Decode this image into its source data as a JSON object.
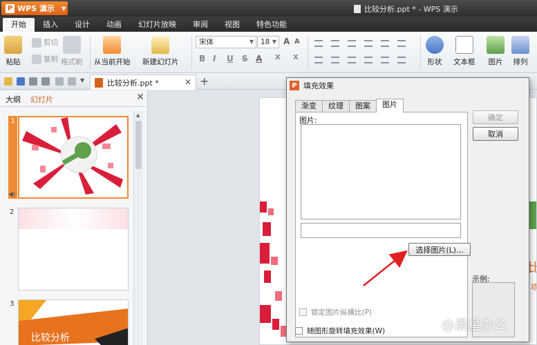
{
  "titlebar": {
    "app_label": "WPS 演示",
    "doc_title": "比较分析.ppt * - WPS 演示"
  },
  "menu": {
    "tabs": [
      "开始",
      "插入",
      "设计",
      "动画",
      "幻灯片放映",
      "审阅",
      "视图",
      "特色功能"
    ]
  },
  "ribbon": {
    "paste": "粘贴",
    "cut": "剪切",
    "copy": "复制",
    "format_painter": "格式刷",
    "from_current": "从当前开始",
    "new_slide": "新建幻灯片",
    "font_name": "宋体",
    "font_size": "18",
    "shapes": "形状",
    "textbox": "文本框",
    "picture": "图片",
    "arrange": "排列"
  },
  "doc_tab": {
    "name": "比较分析.ppt *"
  },
  "left_pane": {
    "tab_outline": "大纲",
    "tab_slides": "幻灯片",
    "slides": [
      {
        "num": "1"
      },
      {
        "num": "2"
      },
      {
        "num": "3",
        "title": "比较分析"
      }
    ]
  },
  "dialog": {
    "title": "填充效果",
    "tabs": [
      "渐变",
      "纹理",
      "图案",
      "图片"
    ],
    "picture_label": "图片:",
    "select_button": "选择图片(L)...",
    "lock_aspect": "锁定图片纵横比(P)",
    "rotate_with_shape": "随图形旋转填充效果(W)",
    "ok": "确定",
    "cancel": "取消",
    "sample_label": "示例:"
  },
  "watermark": "@晨星办公",
  "colors": {
    "accent": "#d9621a",
    "selection": "#f08a34",
    "arrow": "#e02020"
  }
}
